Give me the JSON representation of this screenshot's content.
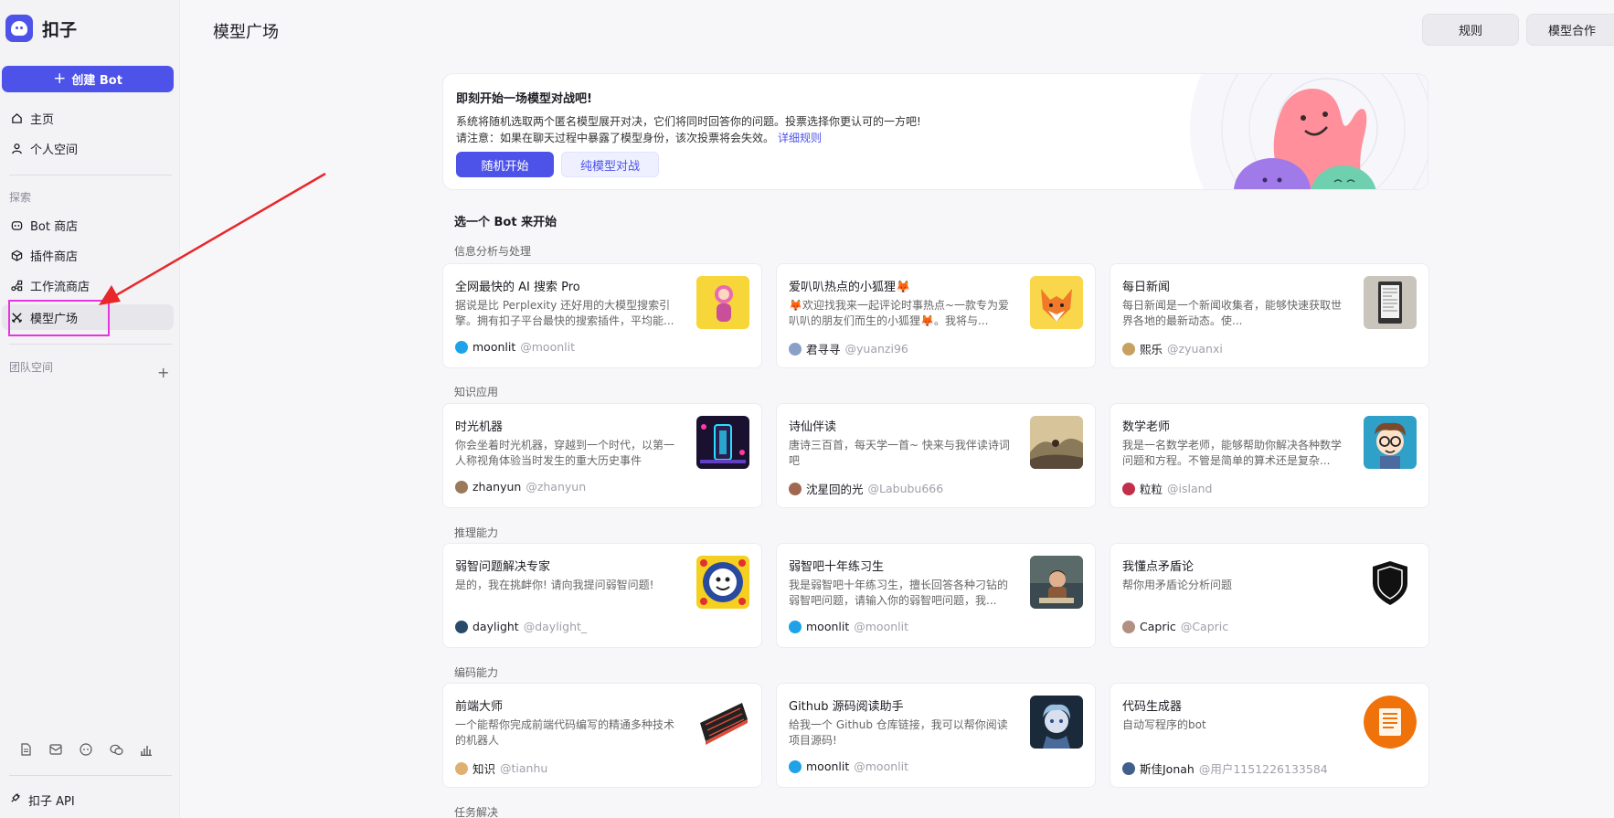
{
  "app": {
    "name": "扣子"
  },
  "sidebar": {
    "create_label": "创建 Bot",
    "home": "主页",
    "personal": "个人空间",
    "explore": "探索",
    "bot_store": "Bot 商店",
    "plugin_store": "插件商店",
    "workflow_store": "工作流商店",
    "model_arena": "模型广场",
    "team_space": "团队空间",
    "api": "扣子 API"
  },
  "header": {
    "title": "模型广场",
    "rules": "规则",
    "cooperation": "模型合作"
  },
  "banner": {
    "title": "即刻开始一场模型对战吧!",
    "desc1": "系统将随机选取两个匿名模型展开对决，它们将同时回答你的问题。投票选择你更认可的一方吧!",
    "desc2": "请注意：如果在聊天过程中暴露了模型身份，该次投票将会失效。",
    "rules_link": "详细规则",
    "btn_random": "随机开始",
    "btn_pure": "纯模型对战"
  },
  "section_title": "选一个 Bot 来开始",
  "categories": [
    {
      "label": "信息分析与处理",
      "cards": [
        {
          "title": "全网最快的 AI 搜索 Pro",
          "desc": "据说是比 Perplexity 还好用的大模型搜索引擎。拥有扣子平台最快的搜索插件，平均能...",
          "author": "moonlit",
          "handle": "@moonlit",
          "avatar": "#1fa2e8"
        },
        {
          "title": "爱叭叭热点的小狐狸🦊",
          "desc": "🦊欢迎找我来一起评论时事热点~一款专为爱叭叭的朋友们而生的小狐狸🦊。我将与...",
          "author": "君寻寻",
          "handle": "@yuanzi96",
          "avatar": "#8aa0c8"
        },
        {
          "title": "每日新闻",
          "desc": "每日新闻是一个新闻收集者，能够快速获取世界各地的最新动态。使...",
          "author": "熙乐",
          "handle": "@zyuanxi",
          "avatar": "#c8a060"
        }
      ]
    },
    {
      "label": "知识应用",
      "cards": [
        {
          "title": "时光机器",
          "desc": "你会坐着时光机器，穿越到一个时代，以第一人称视角体验当时发生的重大历史事件",
          "author": "zhanyun",
          "handle": "@zhanyun",
          "avatar": "#9a7a5a"
        },
        {
          "title": "诗仙伴读",
          "desc": "唐诗三百首，每天学一首~ 快来与我伴读诗词吧",
          "author": "沈星回的光",
          "handle": "@Labubu666",
          "avatar": "#a06850"
        },
        {
          "title": "数学老师",
          "desc": "我是一名数学老师，能够帮助你解决各种数学问题和方程。不管是简单的算术还是复杂...",
          "author": "粒粒",
          "handle": "@island",
          "avatar": "#c0304a"
        }
      ]
    },
    {
      "label": "推理能力",
      "cards": [
        {
          "title": "弱智问题解决专家",
          "desc": "是的，我在挑衅你! 请向我提问弱智问题!",
          "author": "daylight",
          "handle": "@daylight_",
          "avatar": "#2a4a6a"
        },
        {
          "title": "弱智吧十年练习生",
          "desc": "我是弱智吧十年练习生，擅长回答各种刁钻的弱智吧问题，请输入你的弱智吧问题，我...",
          "author": "moonlit",
          "handle": "@moonlit",
          "avatar": "#1fa2e8"
        },
        {
          "title": "我懂点矛盾论",
          "desc": "帮你用矛盾论分析问题",
          "author": "Capric",
          "handle": "@Capric",
          "avatar": "#b09080"
        }
      ]
    },
    {
      "label": "编码能力",
      "cards": [
        {
          "title": "前端大师",
          "desc": "一个能帮你完成前端代码编写的精通多种技术的机器人",
          "author": "知识",
          "handle": "@tianhu",
          "avatar": "#e0b070"
        },
        {
          "title": "Github 源码阅读助手",
          "desc": "给我一个 Github 仓库链接，我可以帮你阅读项目源码!",
          "author": "moonlit",
          "handle": "@moonlit",
          "avatar": "#1fa2e8"
        },
        {
          "title": "代码生成器",
          "desc": "自动写程序的bot",
          "author": "斯佳Jonah",
          "handle": "@用户1151226133584",
          "avatar": "#40608a"
        }
      ]
    },
    {
      "label": "任务解决",
      "cards": []
    }
  ]
}
